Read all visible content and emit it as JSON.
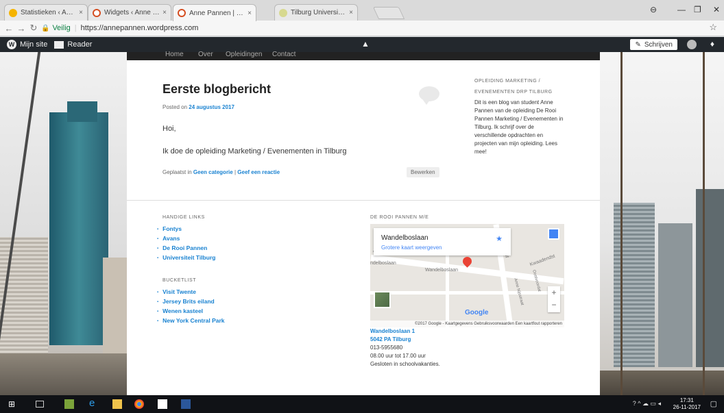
{
  "browser": {
    "tabs": [
      {
        "title": "Statistieken ‹ Anne Panne",
        "close": "×",
        "color": "#f5b400"
      },
      {
        "title": "Widgets ‹ Anne Pannen —",
        "close": "×",
        "color": "#d54e21"
      },
      {
        "title": "Anne Pannen | Blog studi",
        "close": "×",
        "color": "#d54e21"
      },
      {
        "title": "Tilburg University - Bestu",
        "close": "×",
        "color": "#a9b26c"
      }
    ],
    "address": {
      "secure_label": "Veilig",
      "url": "https://annepannen.wordpress.com"
    }
  },
  "adminbar": {
    "my_site": "Mijn site",
    "reader": "Reader",
    "write": "Schrijven"
  },
  "nav": [
    "Home",
    "Over",
    "Opleidingen",
    "Contact"
  ],
  "post": {
    "title": "Eerste blogbericht",
    "posted_prefix": "Posted on ",
    "date": "24 augustus 2017",
    "greeting": "Hoi,",
    "text": "Ik doe de opleiding Marketing / Evenementen in Tilburg",
    "category_prefix": "Geplaatst in ",
    "category": "Geen categorie",
    "meta_sep": " | ",
    "reply": "Geef een reactie",
    "edit": "Bewerken"
  },
  "sidebar": {
    "title": "OPLEIDING MARKETING / EVENEMENTEN DRP TILBURG",
    "text": "Dit is een blog van student Anne Pannen van de opleiding De Rooi Pannen Marketing / Evenementen in Tilburg. Ik schrijf over de verschillende opdrachten en projecten van mijn opleiding. Lees mee!"
  },
  "footer": {
    "links_title": "HANDIGE LINKS",
    "links": [
      "Fontys",
      "Avans",
      "De Rooi Pannen",
      "Universiteit Tilburg"
    ],
    "bucket_title": "BUCKETLIST",
    "bucket": [
      "Visit Twente",
      "Jersey Brits eiland",
      "Wenen kasteel",
      "New York Central Park"
    ],
    "map_title": "DE ROOI PANNEN M/E",
    "map": {
      "place": "Wandelboslaan",
      "larger_map": "Grotere kaart weergeven",
      "street1": "Wandelboslaan",
      "street2": "ndelboslaan",
      "street3": "ververlaan",
      "street4": "West",
      "street5": "Kwaadendst",
      "street6": "Oostvoordat",
      "street7": "Anne Nijsstraat",
      "zoom_in": "+",
      "zoom_out": "−",
      "logo": "Google",
      "attribution": "©2017 Google - Kaartgegevens   Gebruiksvoorwaarden   Een kaartfout rapporteren"
    },
    "address": [
      "Wandelboslaan 1",
      "5042 PA Tilburg"
    ],
    "details": [
      "013-5955680",
      "08.00 uur tot 17.00 uur",
      "Gesloten in schoolvakanties."
    ]
  },
  "taskbar": {
    "time": "17:31",
    "date": "26-11-2017"
  }
}
